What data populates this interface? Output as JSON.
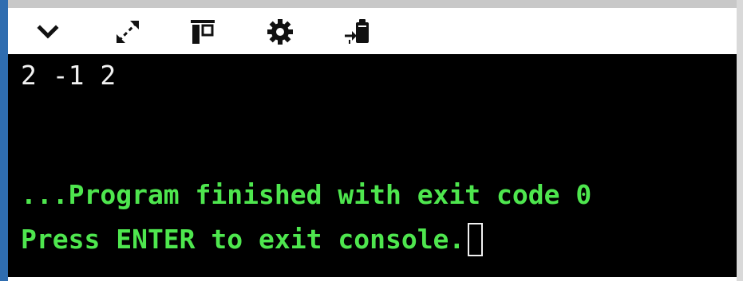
{
  "toolbar": {
    "icons": [
      {
        "name": "chevron-down-icon"
      },
      {
        "name": "expand-icon"
      },
      {
        "name": "layout-toggle-icon"
      },
      {
        "name": "gear-icon"
      },
      {
        "name": "input-debug-icon"
      }
    ]
  },
  "console": {
    "output": "2 -1 2",
    "finished_message": "...Program finished with exit code 0",
    "prompt_message": "Press ENTER to exit console."
  },
  "colors": {
    "console_bg": "#000000",
    "output_text": "#f2f2f2",
    "status_text": "#4ee64e",
    "accent": "#2f6db0"
  }
}
